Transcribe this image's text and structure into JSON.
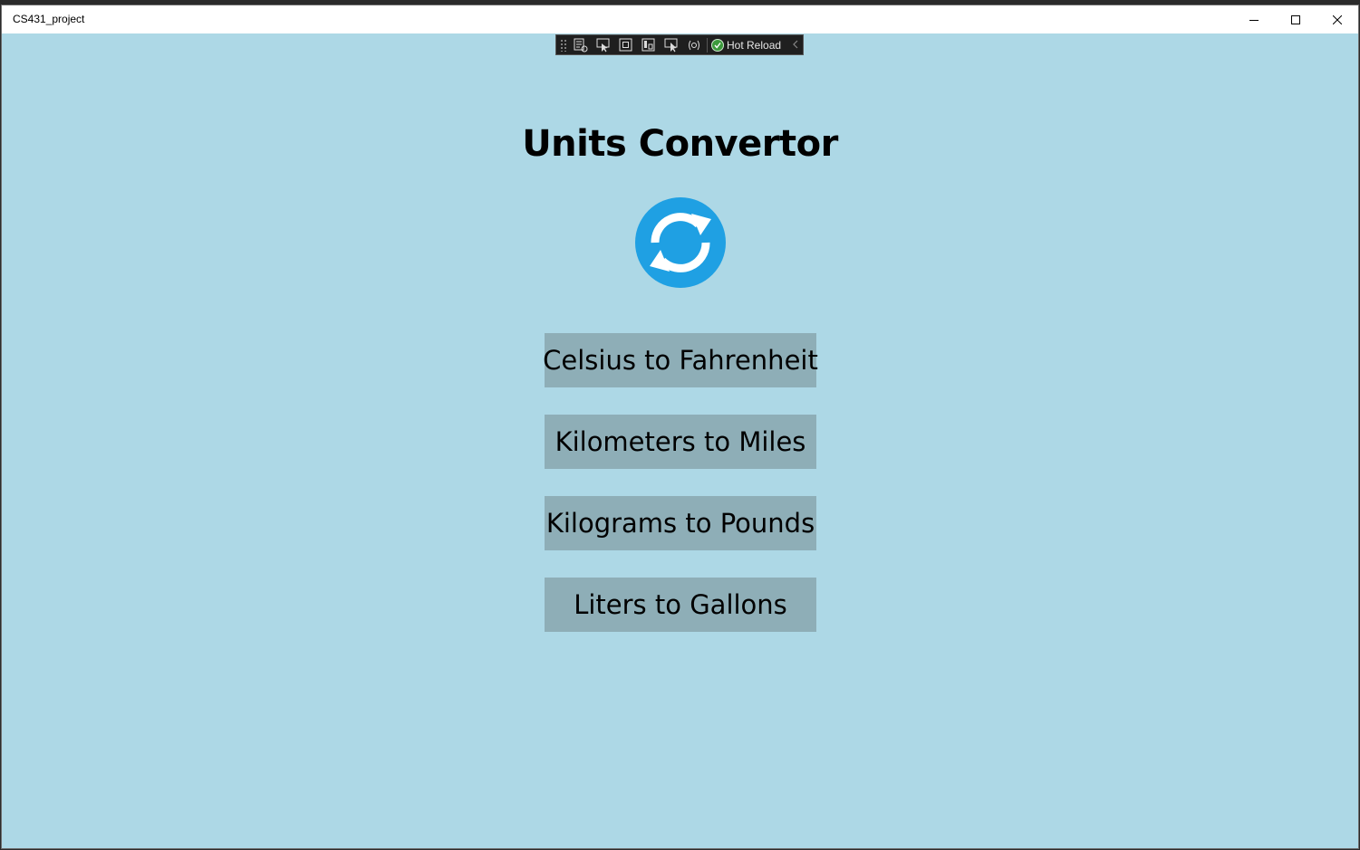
{
  "window": {
    "title": "CS431_project"
  },
  "dev_toolbar": {
    "icons": [
      "live-visual-tree-icon",
      "select-element-icon",
      "display-layout-adorners-icon",
      "track-focus-icon",
      "display-element-icon",
      "xaml-binding-icon"
    ],
    "hot_reload_label": "Hot Reload"
  },
  "main": {
    "title": "Units Convertor",
    "logo_icon": "refresh-arrows-icon",
    "buttons": [
      {
        "label": "Celsius to Fahrenheit"
      },
      {
        "label": "Kilometers to Miles"
      },
      {
        "label": "Kilograms to Pounds"
      },
      {
        "label": "Liters to Gallons"
      }
    ]
  },
  "colors": {
    "background": "#add8e6",
    "button_bg": "#8eaeb7",
    "logo_blue": "#1fa0e3"
  }
}
